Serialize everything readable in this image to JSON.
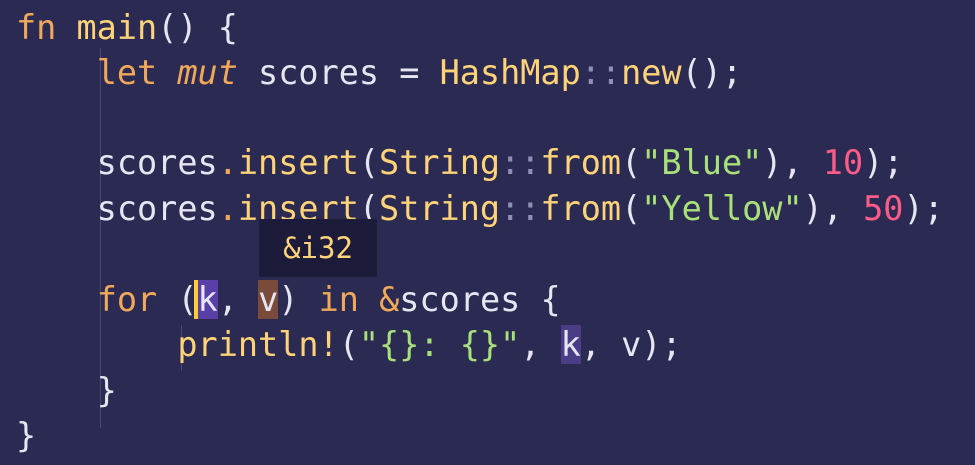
{
  "editor": {
    "language": "rust",
    "lines": [
      {
        "segments": [
          {
            "t": "fn",
            "c": "kw"
          },
          {
            "t": " ",
            "c": "punct"
          },
          {
            "t": "main",
            "c": "fn"
          },
          {
            "t": "() {",
            "c": "punct"
          }
        ]
      },
      {
        "segments": [
          {
            "t": "    ",
            "c": "punct"
          },
          {
            "t": "let",
            "c": "kw"
          },
          {
            "t": " ",
            "c": "punct"
          },
          {
            "t": "mut",
            "c": "ital"
          },
          {
            "t": " scores = ",
            "c": "var"
          },
          {
            "t": "HashMap",
            "c": "type"
          },
          {
            "t": "::",
            "c": "path"
          },
          {
            "t": "new",
            "c": "fn"
          },
          {
            "t": "();",
            "c": "punct"
          }
        ]
      },
      {
        "segments": []
      },
      {
        "segments": [
          {
            "t": "    scores",
            "c": "var"
          },
          {
            "t": ".",
            "c": "kw"
          },
          {
            "t": "insert",
            "c": "fn"
          },
          {
            "t": "(",
            "c": "punct"
          },
          {
            "t": "String",
            "c": "type"
          },
          {
            "t": "::",
            "c": "path"
          },
          {
            "t": "from",
            "c": "fn"
          },
          {
            "t": "(",
            "c": "punct"
          },
          {
            "t": "\"Blue\"",
            "c": "str"
          },
          {
            "t": "), ",
            "c": "punct"
          },
          {
            "t": "10",
            "c": "num"
          },
          {
            "t": ");",
            "c": "punct"
          }
        ]
      },
      {
        "segments": [
          {
            "t": "    scores",
            "c": "var"
          },
          {
            "t": ".",
            "c": "kw"
          },
          {
            "t": "insert",
            "c": "fn"
          },
          {
            "t": "(",
            "c": "punct"
          },
          {
            "t": "String",
            "c": "type"
          },
          {
            "t": "::",
            "c": "path"
          },
          {
            "t": "from",
            "c": "fn"
          },
          {
            "t": "(",
            "c": "punct"
          },
          {
            "t": "\"Yellow\"",
            "c": "str"
          },
          {
            "t": "), ",
            "c": "punct"
          },
          {
            "t": "50",
            "c": "num"
          },
          {
            "t": ");",
            "c": "punct"
          }
        ]
      },
      {
        "segments": []
      },
      {
        "segments": [
          {
            "t": "    ",
            "c": "punct"
          },
          {
            "t": "for",
            "c": "kw"
          },
          {
            "t": " (",
            "c": "punct"
          },
          {
            "t": "k",
            "c": "var hl-k"
          },
          {
            "t": ", ",
            "c": "punct"
          },
          {
            "t": "v",
            "c": "var hl-v"
          },
          {
            "t": ") ",
            "c": "punct"
          },
          {
            "t": "in",
            "c": "kw"
          },
          {
            "t": " ",
            "c": "punct"
          },
          {
            "t": "&",
            "c": "kw"
          },
          {
            "t": "scores {",
            "c": "var"
          }
        ]
      },
      {
        "segments": [
          {
            "t": "        ",
            "c": "punct"
          },
          {
            "t": "println!",
            "c": "mac"
          },
          {
            "t": "(",
            "c": "punct"
          },
          {
            "t": "\"{}: {}\"",
            "c": "str"
          },
          {
            "t": ", ",
            "c": "punct"
          },
          {
            "t": "k",
            "c": "var hl-k2"
          },
          {
            "t": ", v);",
            "c": "punct"
          }
        ]
      },
      {
        "segments": [
          {
            "t": "    }",
            "c": "punct"
          }
        ]
      },
      {
        "segments": [
          {
            "t": "}",
            "c": "punct"
          }
        ]
      }
    ]
  },
  "tooltip": {
    "text": "&i32"
  }
}
